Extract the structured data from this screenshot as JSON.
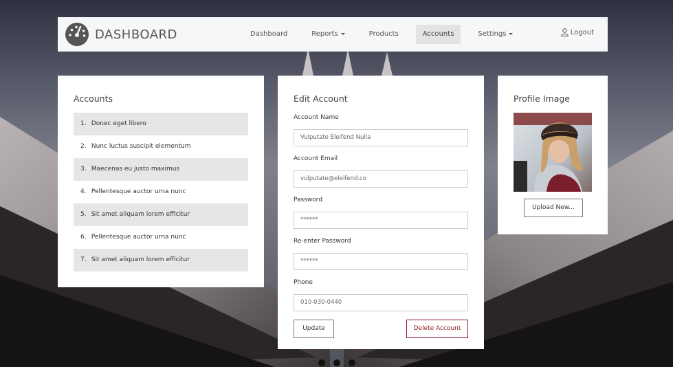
{
  "brand": {
    "title": "DASHBOARD",
    "icon": "speedometer-icon"
  },
  "nav": {
    "items": [
      {
        "label": "Dashboard",
        "dropdown": false,
        "active": false
      },
      {
        "label": "Reports",
        "dropdown": true,
        "active": false
      },
      {
        "label": "Products",
        "dropdown": false,
        "active": false
      },
      {
        "label": "Accounts",
        "dropdown": false,
        "active": true
      },
      {
        "label": "Settings",
        "dropdown": true,
        "active": false
      }
    ],
    "logout_label": "Logout"
  },
  "accounts": {
    "title": "Accounts",
    "items": [
      {
        "num": "1.",
        "label": "Donec eget libero"
      },
      {
        "num": "2.",
        "label": "Nunc luctus suscipit elementum"
      },
      {
        "num": "3.",
        "label": "Maecenas eu justo maximus"
      },
      {
        "num": "4.",
        "label": "Pellentesque auctor urna nunc"
      },
      {
        "num": "5.",
        "label": "Sit amet aliquam lorem efficitur"
      },
      {
        "num": "6.",
        "label": "Pellentesque auctor urna nunc"
      },
      {
        "num": "7.",
        "label": "Sit amet aliquam lorem efficitur"
      }
    ]
  },
  "edit": {
    "title": "Edit Account",
    "fields": {
      "name": {
        "label": "Account Name",
        "value": "Vulputate Eleifend Nulla"
      },
      "email": {
        "label": "Account Email",
        "value": "vulputate@eleifend.co"
      },
      "password": {
        "label": "Password",
        "value": "******"
      },
      "repassword": {
        "label": "Re-enter Password",
        "value": "******"
      },
      "phone": {
        "label": "Phone",
        "value": "010-030-0440"
      }
    },
    "update_label": "Update",
    "delete_label": "Delete Account"
  },
  "profile": {
    "title": "Profile Image",
    "upload_label": "Upload New..."
  },
  "colors": {
    "navbar_bg": "#f6f7f8",
    "active_tab": "#e2e3e4",
    "delete_accent": "#8b1a22",
    "list_alt_row": "#e6e6e6"
  }
}
